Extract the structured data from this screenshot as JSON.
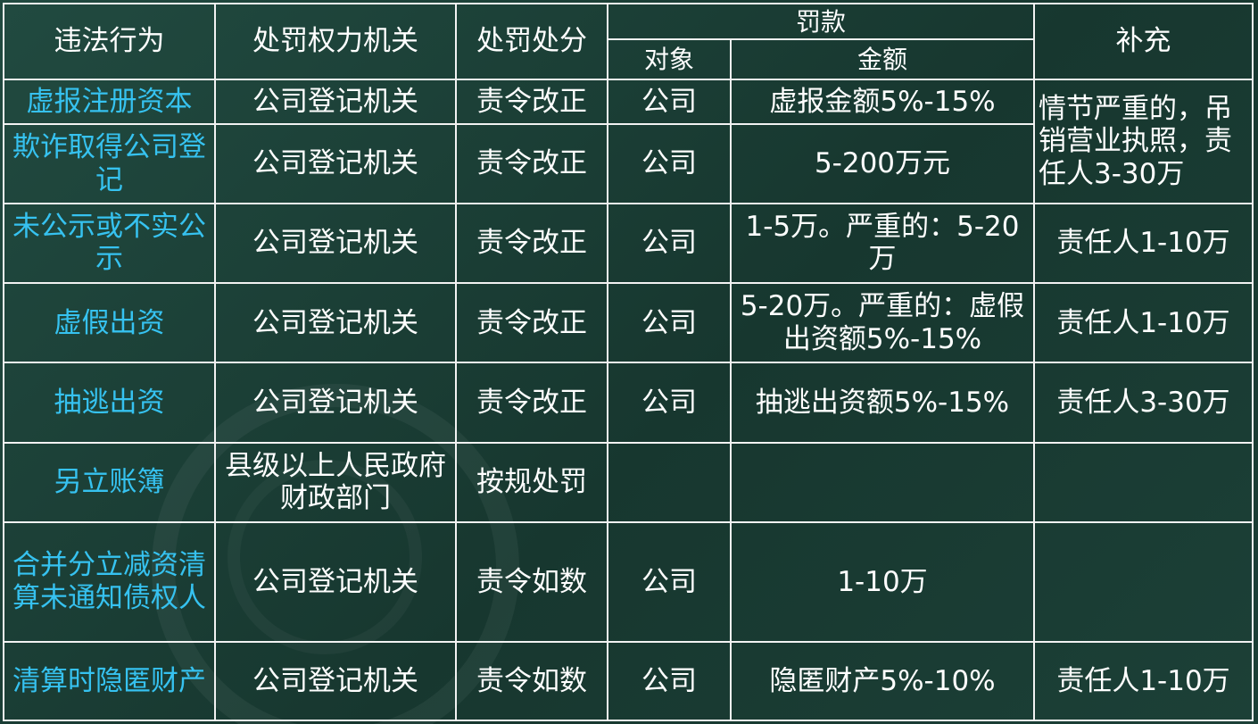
{
  "header": {
    "violation": "违法行为",
    "authority": "处罚权力机关",
    "penalty": "处罚处分",
    "fine": "罚款",
    "target": "对象",
    "amount": "金额",
    "supplement": "补充"
  },
  "rows": [
    {
      "violation": "虚报注册资本",
      "authority": "公司登记机关",
      "penalty": "责令改正",
      "target": "公司",
      "amount": "虚报金额5%-15%",
      "supplement": "情节严重的，吊销营业执照，责任人3-30万"
    },
    {
      "violation": "欺诈取得公司登记",
      "authority": "公司登记机关",
      "penalty": "责令改正",
      "target": "公司",
      "amount": "5-200万元"
    },
    {
      "violation": "未公示或不实公示",
      "authority": "公司登记机关",
      "penalty": "责令改正",
      "target": "公司",
      "amount": "1-5万。严重的：5-20万",
      "supplement": "责任人1-10万"
    },
    {
      "violation": "虚假出资",
      "authority": "公司登记机关",
      "penalty": "责令改正",
      "target": "公司",
      "amount": "5-20万。严重的：虚假出资额5%-15%",
      "supplement": "责任人1-10万"
    },
    {
      "violation": "抽逃出资",
      "authority": "公司登记机关",
      "penalty": "责令改正",
      "target": "公司",
      "amount": "抽逃出资额5%-15%",
      "supplement": "责任人3-30万"
    },
    {
      "violation": "另立账簿",
      "authority": "县级以上人民政府财政部门",
      "penalty": "按规处罚",
      "target": "",
      "amount": "",
      "supplement": ""
    },
    {
      "violation": "合并分立减资清算未通知债权人",
      "authority": "公司登记机关",
      "penalty": "责令如数",
      "target": "公司",
      "amount": "1-10万",
      "supplement": ""
    },
    {
      "violation": "清算时隐匿财产",
      "authority": "公司登记机关",
      "penalty": "责令如数",
      "target": "公司",
      "amount": "隐匿财产5%-10%",
      "supplement": "责任人1-10万"
    }
  ]
}
